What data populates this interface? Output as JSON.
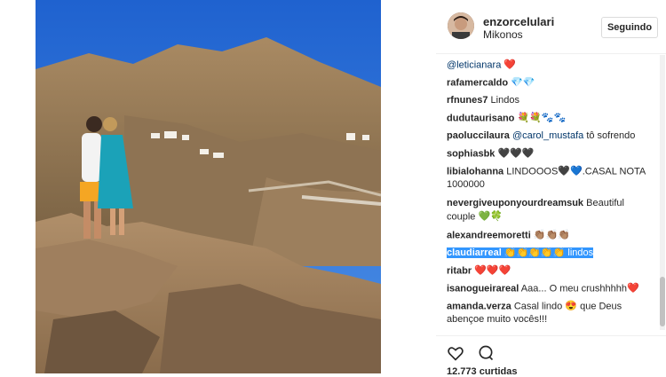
{
  "post": {
    "username": "enzorcelulari",
    "location": "Mikonos",
    "follow_label": "Seguindo",
    "likes_text": "12.773 curtidas"
  },
  "comments": [
    {
      "user": "@leticianara",
      "text": "",
      "emoji": "❤️"
    },
    {
      "user": "rafamercaldo",
      "text": "",
      "emoji": "💎💎"
    },
    {
      "user": "rfnunes7",
      "text": "Lindos",
      "emoji": ""
    },
    {
      "user": "dudutaurisano",
      "text": "",
      "emoji": "💐💐🐾🐾"
    },
    {
      "user": "paoluccilaura",
      "mention": "@carol_mustafa",
      "text": "tô sofrendo",
      "emoji": ""
    },
    {
      "user": "sophiasbk",
      "text": "",
      "emoji": "🖤🖤🖤"
    },
    {
      "user": "libialohanna",
      "text": "LINDOOOS",
      "emoji": "🖤💙",
      "text2": ".CASAL NOTA",
      "line2": "1000000"
    },
    {
      "user": "nevergiveuponyourdreamsuk",
      "text": "Beautiful",
      "line2": "couple",
      "emoji2": "💚🍀"
    },
    {
      "user": "alexandreemoretti",
      "text": "",
      "emoji": "👏🏽👏🏽👏🏽"
    },
    {
      "user": "claudiarreal",
      "text": "lindos",
      "emoji": "👏👏👏👏👏"
    },
    {
      "user": "ritabr",
      "text": "",
      "emoji": "❤️❤️❤️"
    },
    {
      "user": "isanogueirareal",
      "text": "Aaa... O meu crushhhhh",
      "emoji": "❤️"
    },
    {
      "user": "amanda.verza",
      "text": "Casal lindo",
      "emoji": "😍",
      "text2": "que Deus",
      "line2": "abençoe muito vocês!!!"
    }
  ],
  "colors": {
    "heart": "#ed4956",
    "diamond": "#3897f0",
    "selection": "#3296fe"
  }
}
